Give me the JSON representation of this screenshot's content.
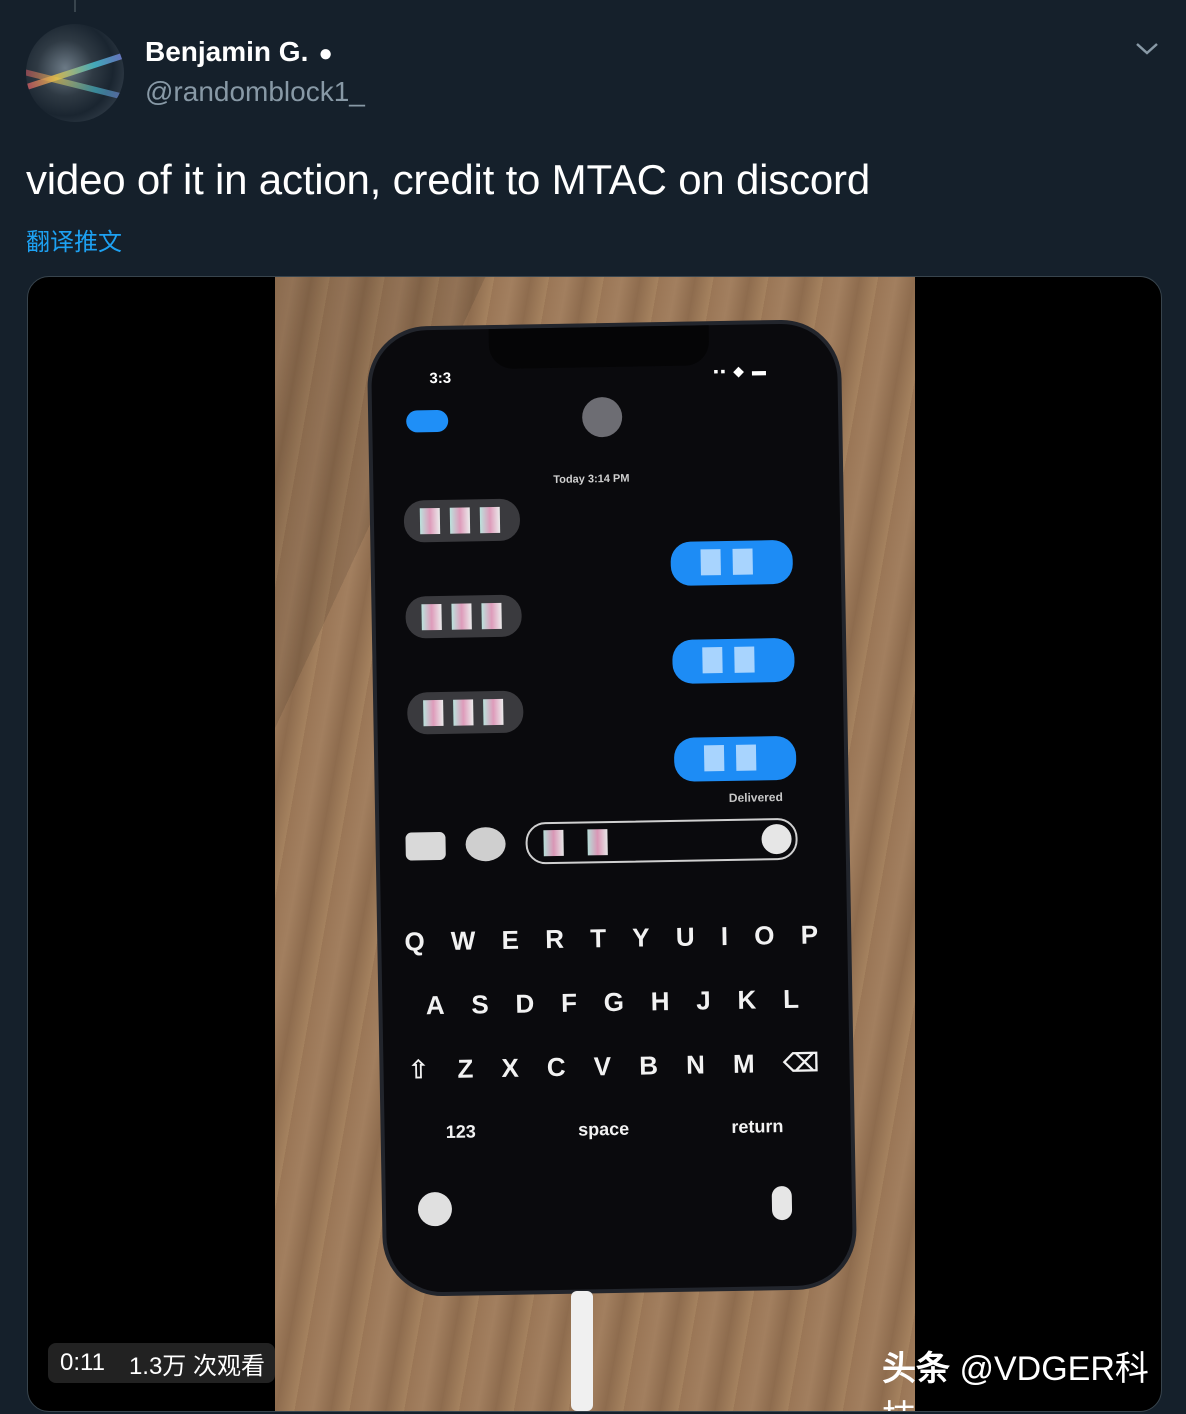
{
  "tweet": {
    "author_name": "Benjamin G.",
    "author_icon": "apple-icon",
    "handle": "@randomblock1_",
    "text": "video of it in action, credit to MTAC on discord",
    "translate_label": "翻译推文"
  },
  "video": {
    "duration": "0:11",
    "views": "1.3万 次观看",
    "watermark_prefix": "头条",
    "watermark_name": "@VDGER科技"
  },
  "phone_screen": {
    "convo_time": "Today 3:14 PM",
    "delivered": "Delivered",
    "keyboard": {
      "row1": [
        "Q",
        "W",
        "E",
        "R",
        "T",
        "Y",
        "U",
        "I",
        "O",
        "P"
      ],
      "row2": [
        "A",
        "S",
        "D",
        "F",
        "G",
        "H",
        "J",
        "K",
        "L"
      ],
      "row3": [
        "⇧",
        "Z",
        "X",
        "C",
        "V",
        "B",
        "N",
        "M",
        "⌫"
      ],
      "row4": [
        "123",
        "space",
        "return"
      ]
    }
  },
  "colors": {
    "background": "#15202b",
    "link": "#1da1f2",
    "secondary_text": "#8899a6"
  }
}
